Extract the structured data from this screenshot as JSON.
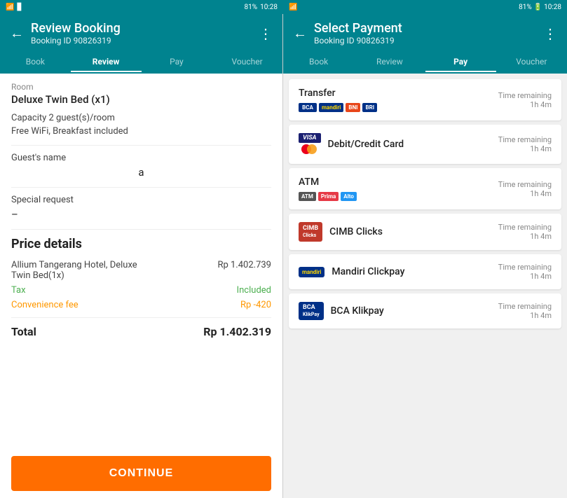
{
  "left": {
    "statusBar": {
      "time": "10:28",
      "battery": "81%"
    },
    "header": {
      "title": "Review Booking",
      "subtitle": "Booking ID 90826319",
      "moreIcon": "⋮",
      "backIcon": "←"
    },
    "breadcrumbs": [
      {
        "label": "Book",
        "state": "done"
      },
      {
        "label": "Review",
        "state": "active"
      },
      {
        "label": "Pay",
        "state": ""
      },
      {
        "label": "Voucher",
        "state": ""
      }
    ],
    "room": {
      "sectionLabel": "Room",
      "roomName": "Deluxe Twin Bed (x1)",
      "capacity": "Capacity 2 guest(s)/room",
      "amenities": "Free WiFi, Breakfast included"
    },
    "guest": {
      "label": "Guest's name",
      "value": "a"
    },
    "specialRequest": {
      "label": "Special request",
      "value": "–"
    },
    "priceDetails": {
      "title": "Price details",
      "rows": [
        {
          "label": "Allium Tangerang Hotel, Deluxe Twin Bed(1x)",
          "value": "Rp 1.402.739",
          "labelClass": "",
          "valueClass": ""
        },
        {
          "label": "Tax",
          "value": "Included",
          "labelClass": "green",
          "valueClass": "green"
        },
        {
          "label": "Convenience fee",
          "value": "Rp -420",
          "labelClass": "orange",
          "valueClass": "orange"
        }
      ],
      "total": {
        "label": "Total",
        "value": "Rp 1.402.319"
      }
    },
    "continueButton": "CONTINUE"
  },
  "right": {
    "header": {
      "title": "Select Payment",
      "subtitle": "Booking ID 90826319",
      "moreIcon": "⋮",
      "backIcon": "←"
    },
    "breadcrumbs": [
      {
        "label": "Book",
        "state": "done"
      },
      {
        "label": "Review",
        "state": "done"
      },
      {
        "label": "Pay",
        "state": "active"
      },
      {
        "label": "Voucher",
        "state": ""
      }
    ],
    "payments": [
      {
        "name": "Transfer",
        "logos": [
          "BCA",
          "mandiri",
          "BNI",
          "BRI"
        ],
        "timeLabel": "Time remaining",
        "timeValue": "1h 4m"
      },
      {
        "name": "Debit/Credit Card",
        "logos": [
          "VISA",
          "MC"
        ],
        "timeLabel": "Time remaining",
        "timeValue": "1h 4m"
      },
      {
        "name": "ATM",
        "logos": [
          "ATM",
          "Prima",
          "Alto"
        ],
        "timeLabel": "Time remaining",
        "timeValue": "1h 4m"
      },
      {
        "name": "CIMB Clicks",
        "logos": [
          "CIMB"
        ],
        "timeLabel": "Time remaining",
        "timeValue": "1h 4m"
      },
      {
        "name": "Mandiri Clickpay",
        "logos": [
          "Mandiri"
        ],
        "timeLabel": "Time remaining",
        "timeValue": "1h 4m"
      },
      {
        "name": "BCA Klikpay",
        "logos": [
          "BCA"
        ],
        "timeLabel": "Time remaining",
        "timeValue": "1h 4m"
      }
    ]
  }
}
